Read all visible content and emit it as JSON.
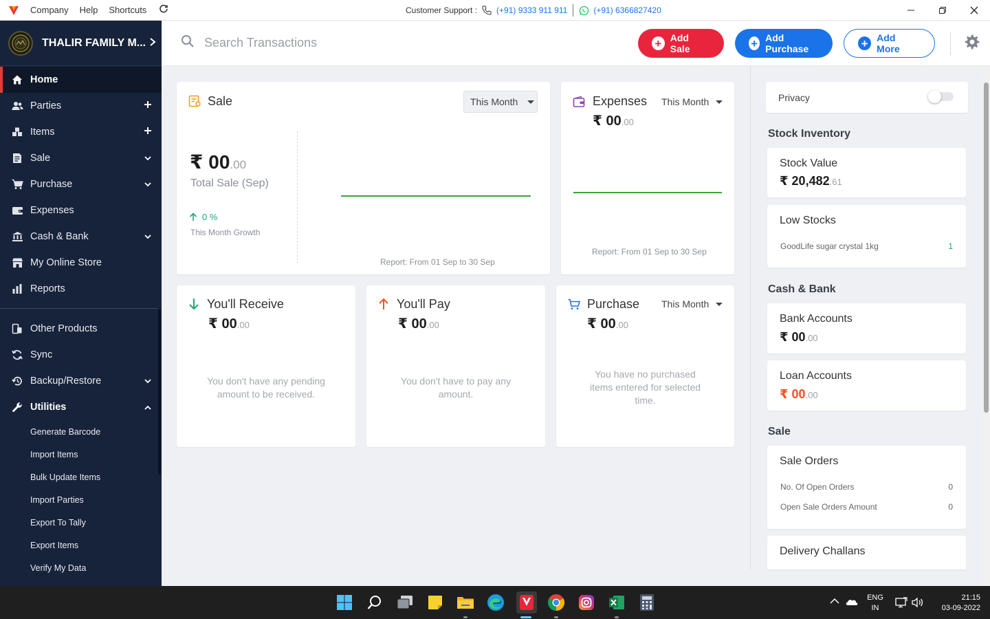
{
  "titlebar": {
    "menu": [
      "Company",
      "Help",
      "Shortcuts"
    ],
    "support_label": "Customer Support :",
    "phone": "(+91) 9333 911 911",
    "whatsapp": "(+91) 6366827420"
  },
  "sidebar": {
    "company_name": "THALIR FAMILY M...",
    "items": [
      {
        "label": "Home"
      },
      {
        "label": "Parties"
      },
      {
        "label": "Items"
      },
      {
        "label": "Sale"
      },
      {
        "label": "Purchase"
      },
      {
        "label": "Expenses"
      },
      {
        "label": "Cash & Bank"
      },
      {
        "label": "My Online Store"
      },
      {
        "label": "Reports"
      }
    ],
    "items2": [
      {
        "label": "Other Products"
      },
      {
        "label": "Sync"
      },
      {
        "label": "Backup/Restore"
      },
      {
        "label": "Utilities"
      }
    ],
    "utilities": [
      "Generate Barcode",
      "Import Items",
      "Bulk Update Items",
      "Import Parties",
      "Export To Tally",
      "Export Items",
      "Verify My Data"
    ]
  },
  "topbar": {
    "search_placeholder": "Search Transactions",
    "add_sale": "Add Sale",
    "add_purchase": "Add Purchase",
    "add_more": "Add More"
  },
  "sale_card": {
    "title": "Sale",
    "period": "This Month",
    "currency": "₹",
    "amount": "00",
    "amount_dec": ".00",
    "subtitle": "Total Sale (Sep)",
    "growth": "0 %",
    "growth_label": "This Month Growth",
    "report": "Report: From 01 Sep to 30 Sep"
  },
  "expenses_card": {
    "title": "Expenses",
    "period": "This Month",
    "currency": "₹",
    "amount": "00",
    "amount_dec": ".00",
    "report": "Report: From 01 Sep to 30 Sep"
  },
  "receive_card": {
    "title": "You'll Receive",
    "currency": "₹",
    "amount": "00",
    "amount_dec": ".00",
    "empty_line1": "You don't have any pending",
    "empty_line2": "amount to be received."
  },
  "pay_card": {
    "title": "You'll Pay",
    "currency": "₹",
    "amount": "00",
    "amount_dec": ".00",
    "empty_line1": "You don't have to pay any",
    "empty_line2": "amount."
  },
  "purchase_card": {
    "title": "Purchase",
    "period": "This Month",
    "currency": "₹",
    "amount": "00",
    "amount_dec": ".00",
    "empty_line1": "You have no purchased",
    "empty_line2": "items entered for selected",
    "empty_line3": "time."
  },
  "right_panel": {
    "privacy": "Privacy",
    "stock_section": "Stock Inventory",
    "stock_value_title": "Stock Value",
    "stock_value_currency": "₹",
    "stock_value": "20,482",
    "stock_value_dec": ".61",
    "low_stocks_title": "Low Stocks",
    "low_stock_item": "GoodLife sugar crystal 1kg",
    "low_stock_qty": "1",
    "cash_section": "Cash & Bank",
    "bank_title": "Bank Accounts",
    "bank_currency": "₹",
    "bank_amount": "00",
    "bank_dec": ".00",
    "loan_title": "Loan Accounts",
    "loan_currency": "₹",
    "loan_amount": "00",
    "loan_dec": ".00",
    "sale_section": "Sale",
    "sale_orders_title": "Sale Orders",
    "open_orders_label": "No. Of Open Orders",
    "open_orders_value": "0",
    "open_amount_label": "Open Sale Orders Amount",
    "open_amount_value": "0",
    "delivery_title": "Delivery Challans"
  },
  "taskbar": {
    "lang": "ENG",
    "region": "IN",
    "time": "21:15",
    "date": "03-09-2022"
  },
  "colors": {
    "sidebar_bg": "#17233a",
    "active_accent": "#e53935",
    "sale_button": "#e8253d",
    "purchase_button": "#1a73e8",
    "chart_line": "#3aa335",
    "growth": "#19a974",
    "loan_amount": "#f4511e"
  }
}
